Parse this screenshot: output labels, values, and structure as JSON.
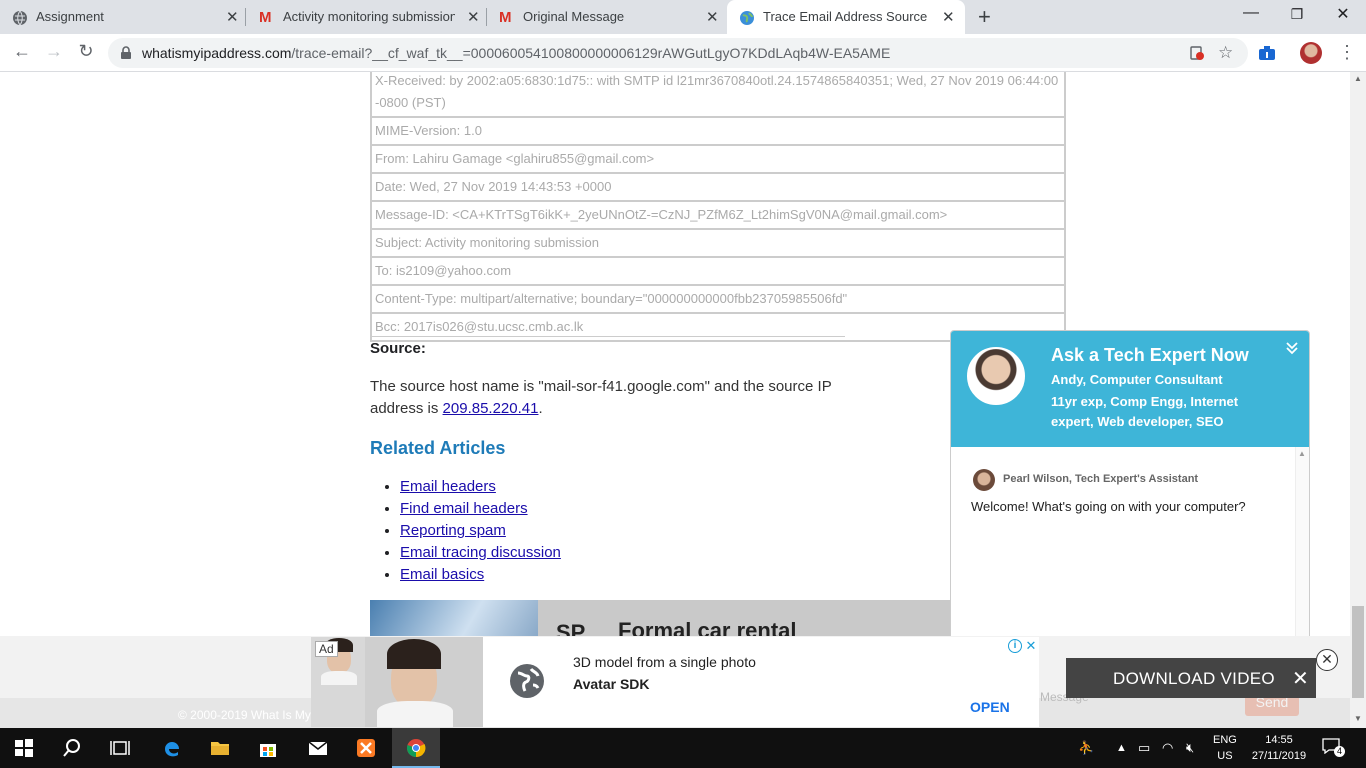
{
  "browser": {
    "tabs": [
      {
        "title": "Assignment",
        "icon": "globe-icon"
      },
      {
        "title": "Activity monitoring submission -",
        "icon": "gmail-icon"
      },
      {
        "title": "Original Message",
        "icon": "gmail-icon"
      },
      {
        "title": "Trace Email Address Source",
        "icon": "globe-icon",
        "active": true
      }
    ],
    "new_tab_label": "+",
    "url_host": "whatismyipaddress.com",
    "url_path": "/trace-email?__cf_waf_tk__=000060054100800000006129rAWGutLgyO7KDdLAqb4W-EA5AME"
  },
  "header_rows": [
    "X-Received: by 2002:a05:6830:1d75:: with SMTP id l21mr3670840otl.24.1574865840351; Wed, 27 Nov 2019 06:44:00 -0800 (PST)",
    "MIME-Version: 1.0",
    "From: Lahiru Gamage <glahiru855@gmail.com>",
    "Date: Wed, 27 Nov 2019 14:43:53 +0000",
    "Message-ID: <CA+KTrTSgT6ikK+_2yeUNnOtZ-=CzNJ_PZfM6Z_Lt2himSgV0NA@mail.gmail.com>",
    "Subject: Activity monitoring submission",
    "To: is2109@yahoo.com",
    "Content-Type: multipart/alternative; boundary=\"000000000000fbb23705985506fd\"",
    "Bcc: 2017is026@stu.ucsc.cmb.ac.lk"
  ],
  "source": {
    "label": "Source:",
    "text_before": "The source host name is \"mail-sor-f41.google.com\" and the source IP address is ",
    "ip": "209.85.220.41",
    "text_after": "."
  },
  "related": {
    "heading": "Related Articles",
    "links": [
      "Email headers",
      "Find email headers",
      "Reporting spam",
      "Email tracing discussion",
      "Email basics"
    ]
  },
  "car_ad": {
    "prefix": "SP",
    "text": "Formal car rental"
  },
  "chat_widget": {
    "title": "Ask a Tech Expert Now",
    "expert": "Andy, Computer Consultant",
    "description": "11yr exp, Comp Engg, Internet expert, Web developer, SEO",
    "assistant": "Pearl Wilson, Tech Expert's Assistant",
    "welcome": "Welcome! What's going on with your computer?",
    "send_label": "Send",
    "message_hint": "Message"
  },
  "footer": {
    "copyright": "© 2000-2019 What Is My"
  },
  "bottom_ad": {
    "badge": "Ad",
    "line1": "3D model from a single photo",
    "line2": "Avatar SDK",
    "cta": "OPEN",
    "info": "i",
    "close": "✕"
  },
  "download_video": {
    "label": "DOWNLOAD VIDEO",
    "close": "✕",
    "circle_close": "✕"
  },
  "taskbar": {
    "lang_line1": "ENG",
    "lang_line2": "US",
    "time": "14:55",
    "date": "27/11/2019",
    "notifications": "4"
  }
}
